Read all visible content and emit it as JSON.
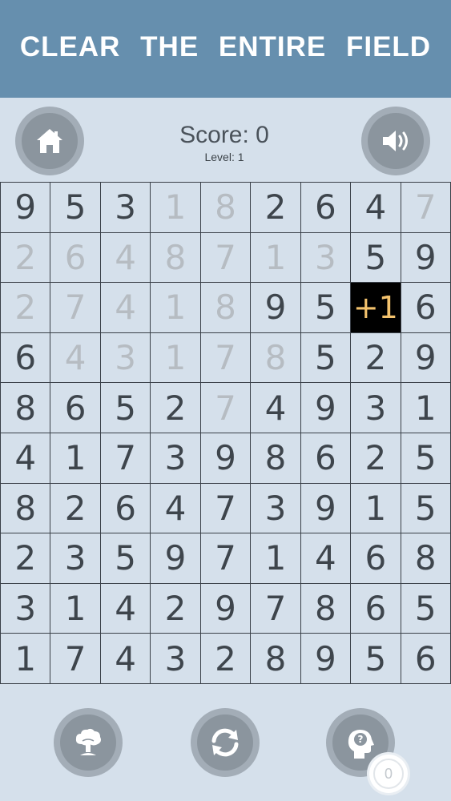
{
  "header": {
    "title": "CLEAR THE ENTIRE FIELD"
  },
  "toolbar": {
    "home_icon": "home-icon",
    "sound_icon": "speaker-icon"
  },
  "score": {
    "label": "Score: 0",
    "value": 0,
    "level_label": "Level: 1"
  },
  "grid": {
    "columns": 9,
    "rows": [
      [
        {
          "v": "9",
          "s": "active"
        },
        {
          "v": "5",
          "s": "active"
        },
        {
          "v": "3",
          "s": "active"
        },
        {
          "v": "1",
          "s": "cleared"
        },
        {
          "v": "8",
          "s": "cleared"
        },
        {
          "v": "2",
          "s": "active"
        },
        {
          "v": "6",
          "s": "active"
        },
        {
          "v": "4",
          "s": "active"
        },
        {
          "v": "7",
          "s": "cleared"
        }
      ],
      [
        {
          "v": "2",
          "s": "cleared"
        },
        {
          "v": "6",
          "s": "cleared"
        },
        {
          "v": "4",
          "s": "cleared"
        },
        {
          "v": "8",
          "s": "cleared"
        },
        {
          "v": "7",
          "s": "cleared"
        },
        {
          "v": "1",
          "s": "cleared"
        },
        {
          "v": "3",
          "s": "cleared"
        },
        {
          "v": "5",
          "s": "active"
        },
        {
          "v": "9",
          "s": "active"
        }
      ],
      [
        {
          "v": "2",
          "s": "cleared"
        },
        {
          "v": "7",
          "s": "cleared"
        },
        {
          "v": "4",
          "s": "cleared"
        },
        {
          "v": "1",
          "s": "cleared"
        },
        {
          "v": "8",
          "s": "cleared"
        },
        {
          "v": "9",
          "s": "active"
        },
        {
          "v": "5",
          "s": "active"
        },
        {
          "v": "+1",
          "s": "highlight"
        },
        {
          "v": "6",
          "s": "active"
        }
      ],
      [
        {
          "v": "6",
          "s": "active"
        },
        {
          "v": "4",
          "s": "cleared"
        },
        {
          "v": "3",
          "s": "cleared"
        },
        {
          "v": "1",
          "s": "cleared"
        },
        {
          "v": "7",
          "s": "cleared"
        },
        {
          "v": "8",
          "s": "cleared"
        },
        {
          "v": "5",
          "s": "active"
        },
        {
          "v": "2",
          "s": "active"
        },
        {
          "v": "9",
          "s": "active"
        }
      ],
      [
        {
          "v": "8",
          "s": "active"
        },
        {
          "v": "6",
          "s": "active"
        },
        {
          "v": "5",
          "s": "active"
        },
        {
          "v": "2",
          "s": "active"
        },
        {
          "v": "7",
          "s": "cleared"
        },
        {
          "v": "4",
          "s": "active"
        },
        {
          "v": "9",
          "s": "active"
        },
        {
          "v": "3",
          "s": "active"
        },
        {
          "v": "1",
          "s": "active"
        }
      ],
      [
        {
          "v": "4",
          "s": "active"
        },
        {
          "v": "1",
          "s": "active"
        },
        {
          "v": "7",
          "s": "active"
        },
        {
          "v": "3",
          "s": "active"
        },
        {
          "v": "9",
          "s": "active"
        },
        {
          "v": "8",
          "s": "active"
        },
        {
          "v": "6",
          "s": "active"
        },
        {
          "v": "2",
          "s": "active"
        },
        {
          "v": "5",
          "s": "active"
        }
      ],
      [
        {
          "v": "8",
          "s": "active"
        },
        {
          "v": "2",
          "s": "active"
        },
        {
          "v": "6",
          "s": "active"
        },
        {
          "v": "4",
          "s": "active"
        },
        {
          "v": "7",
          "s": "active"
        },
        {
          "v": "3",
          "s": "active"
        },
        {
          "v": "9",
          "s": "active"
        },
        {
          "v": "1",
          "s": "active"
        },
        {
          "v": "5",
          "s": "active"
        }
      ],
      [
        {
          "v": "2",
          "s": "active"
        },
        {
          "v": "3",
          "s": "active"
        },
        {
          "v": "5",
          "s": "active"
        },
        {
          "v": "9",
          "s": "active"
        },
        {
          "v": "7",
          "s": "active"
        },
        {
          "v": "1",
          "s": "active"
        },
        {
          "v": "4",
          "s": "active"
        },
        {
          "v": "6",
          "s": "active"
        },
        {
          "v": "8",
          "s": "active"
        }
      ],
      [
        {
          "v": "3",
          "s": "active"
        },
        {
          "v": "1",
          "s": "active"
        },
        {
          "v": "4",
          "s": "active"
        },
        {
          "v": "2",
          "s": "active"
        },
        {
          "v": "9",
          "s": "active"
        },
        {
          "v": "7",
          "s": "active"
        },
        {
          "v": "8",
          "s": "active"
        },
        {
          "v": "6",
          "s": "active"
        },
        {
          "v": "5",
          "s": "active"
        }
      ],
      [
        {
          "v": "1",
          "s": "active"
        },
        {
          "v": "7",
          "s": "active"
        },
        {
          "v": "4",
          "s": "active"
        },
        {
          "v": "3",
          "s": "active"
        },
        {
          "v": "2",
          "s": "active"
        },
        {
          "v": "8",
          "s": "active"
        },
        {
          "v": "9",
          "s": "active"
        },
        {
          "v": "5",
          "s": "active"
        },
        {
          "v": "6",
          "s": "active"
        }
      ]
    ]
  },
  "bottom_bar": {
    "bomb_icon": "explosion-icon",
    "restart_icon": "refresh-icon",
    "hint_icon": "head-question-icon",
    "hint_count": "0"
  },
  "colors": {
    "header_bg": "#668fae",
    "page_bg": "#d5e0eb",
    "active_digit": "#3e454c",
    "cleared_digit": "#b6bcc2",
    "highlight_bg": "#000000",
    "highlight_text": "#f3c26d"
  }
}
